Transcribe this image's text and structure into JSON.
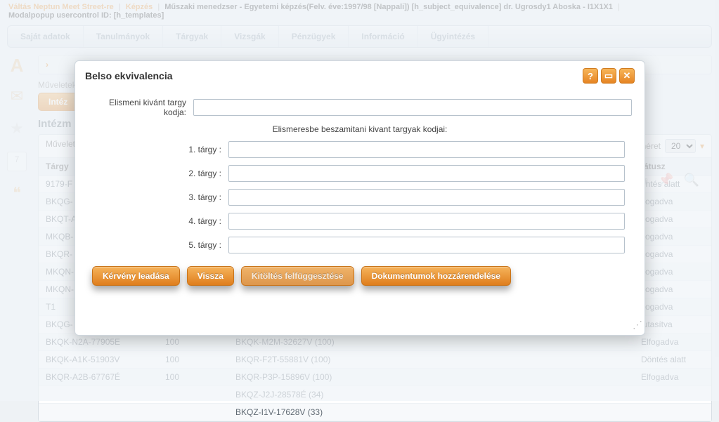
{
  "topbar": {
    "link1": "Váltás Neptun Meet Street-re",
    "link2": "Képzés",
    "training_desc": "Műszaki menedzser - Egyetemi képzés(Felv. éve:1997/98 [Nappali]) [h_subject_equivalence] dr. Ugrosdy1 Aboska - I1X1X1",
    "line2": "Modalpopup usercontrol ID: [h_templates]"
  },
  "menu": {
    "items": [
      "Saját adatok",
      "Tanulmányok",
      "Tárgyak",
      "Vizsgák",
      "Pénzügyek",
      "Információ",
      "Ügyintézés"
    ]
  },
  "crumb": {
    "chevron": "›"
  },
  "labels": {
    "muveletek": "Műveletek",
    "intezmenyi_btn": "Intéz",
    "section_title": "Intézm",
    "page_size_label": "lméret",
    "page_size_value": "20"
  },
  "grid": {
    "cols": [
      "Tárgy",
      "",
      "",
      "tátusz"
    ],
    "rows": [
      {
        "c1": "9179-F",
        "c2": "",
        "c3": "",
        "c4": "öntés alatt"
      },
      {
        "c1": "BKQG-",
        "c2": "",
        "c3": "",
        "c4": "lfogadva"
      },
      {
        "c1": "BKQT-A",
        "c2": "",
        "c3": "",
        "c4": "lfogadva"
      },
      {
        "c1": "MKQB-",
        "c2": "",
        "c3": "",
        "c4": "lfogadva"
      },
      {
        "c1": "BKQR-",
        "c2": "",
        "c3": "",
        "c4": "lfogadva"
      },
      {
        "c1": "MKQN-",
        "c2": "",
        "c3": "",
        "c4": "lfogadva"
      },
      {
        "c1": "MKQN-",
        "c2": "",
        "c3": "",
        "c4": "lfogadva"
      },
      {
        "c1": "T1",
        "c2": "",
        "c3": "",
        "c4": "lfogadva"
      },
      {
        "c1": "BKQG-",
        "c2": "",
        "c3": "",
        "c4": "lutasítva"
      },
      {
        "c1": "BKQK-N2A-77905E",
        "c2": "100",
        "c3": "BKQK-M2M-32627V (100)",
        "c4": "Elfogadva"
      },
      {
        "c1": "BKQK-A1K-51903V",
        "c2": "100",
        "c3": "BKQR-F2T-55881V (100)",
        "c4": "Döntés alatt"
      },
      {
        "c1": "BKQR-A2B-67767É",
        "c2": "100",
        "c3": "BKQR-P3P-15896V (100)",
        "c4": "Elfogadva"
      },
      {
        "c1": "",
        "c2": "",
        "c3": "BKQZ-J2J-28578É (34)",
        "c4": ""
      },
      {
        "c1": "",
        "c2": "",
        "c3": "BKQZ-I1V-17628V (33)",
        "c4": ""
      }
    ]
  },
  "modal": {
    "title": "Belso ekvivalencia",
    "help": "?",
    "max": "▭",
    "close": "✕",
    "field_main_label": "Elismeni kivánt targy kodja:",
    "sub_title": "Elismeresbe beszamitani kivant targyak kodjai:",
    "t_labels": [
      "1. tárgy :",
      "2. tárgy :",
      "3. tárgy :",
      "4. tárgy :",
      "5. tárgy :"
    ],
    "buttons": {
      "submit": "Kérvény leadása",
      "back": "Vissza",
      "suspend": "Kitöltés felfüggesztése",
      "docs": "Dokumentumok hozzárendelése"
    }
  }
}
